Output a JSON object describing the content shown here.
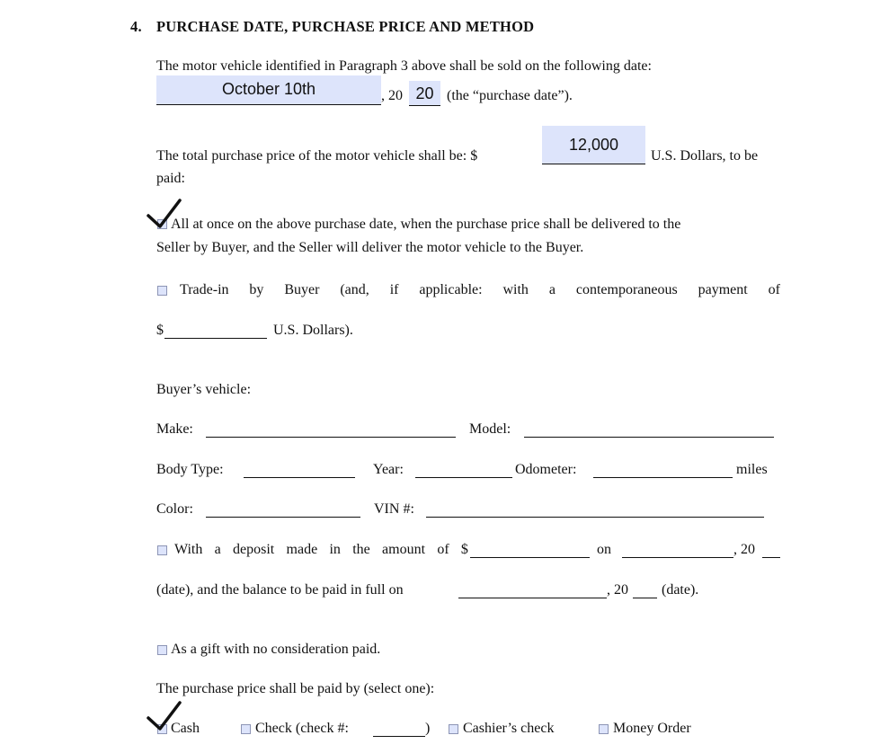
{
  "section": {
    "number": "4.",
    "title": "PURCHASE DATE, PURCHASE PRICE AND METHOD"
  },
  "purchase_date": {
    "intro": "The motor vehicle identified in Paragraph 3 above shall be sold on the following date:",
    "date_value": "October 10th",
    "year_prefix": ", 20",
    "year_value": "20",
    "suffix": "(the “purchase date”)."
  },
  "purchase_price": {
    "prefix": "The total purchase price of the motor vehicle shall be: $",
    "value": "12,000",
    "suffix": "U.S. Dollars, to be",
    "line2": "paid:"
  },
  "options": {
    "all_at_once": {
      "checked": true,
      "line1": "All at once on the above purchase date, when the purchase price shall be delivered to the",
      "line2": "Seller by Buyer, and the Seller will deliver the motor vehicle to the Buyer."
    },
    "trade_in": {
      "checked": false,
      "words": [
        "Trade-in",
        "by",
        "Buyer",
        "(and,",
        "if",
        "applicable:",
        "with",
        "a",
        "contemporaneous",
        "payment",
        "of"
      ],
      "dollar": "$",
      "suffix": "U.S. Dollars)."
    },
    "buyers_vehicle": {
      "label": "Buyer’s vehicle:",
      "make": "Make:",
      "model": "Model:",
      "body_type": "Body Type:",
      "year": "Year:",
      "odometer": "Odometer:",
      "miles": "miles",
      "color": "Color:",
      "vin": "VIN #:"
    },
    "deposit": {
      "checked": false,
      "words": [
        "With",
        "a",
        "deposit",
        "made",
        "in",
        "the",
        "amount",
        "of",
        "$"
      ],
      "on": "on",
      "year_prefix": ", 20",
      "line2_prefix": "(date), and the balance to be paid in full on",
      "line2_year": ", 20",
      "line2_suffix": "(date)."
    },
    "gift": {
      "checked": false,
      "label": "As a gift with no consideration paid."
    }
  },
  "payment_method": {
    "prompt": "The purchase price shall be paid by (select one):",
    "cash": {
      "label": "Cash",
      "checked": true
    },
    "check": {
      "label": "Check (check #:",
      "close": ")",
      "checked": false
    },
    "cashiers_check": {
      "label": "Cashier’s check",
      "checked": false
    },
    "money_order": {
      "label": "Money Order",
      "checked": false
    }
  },
  "colors": {
    "field_fill": "#dde4fb",
    "checkbox_border": "#8d95b5",
    "text": "#111111"
  }
}
